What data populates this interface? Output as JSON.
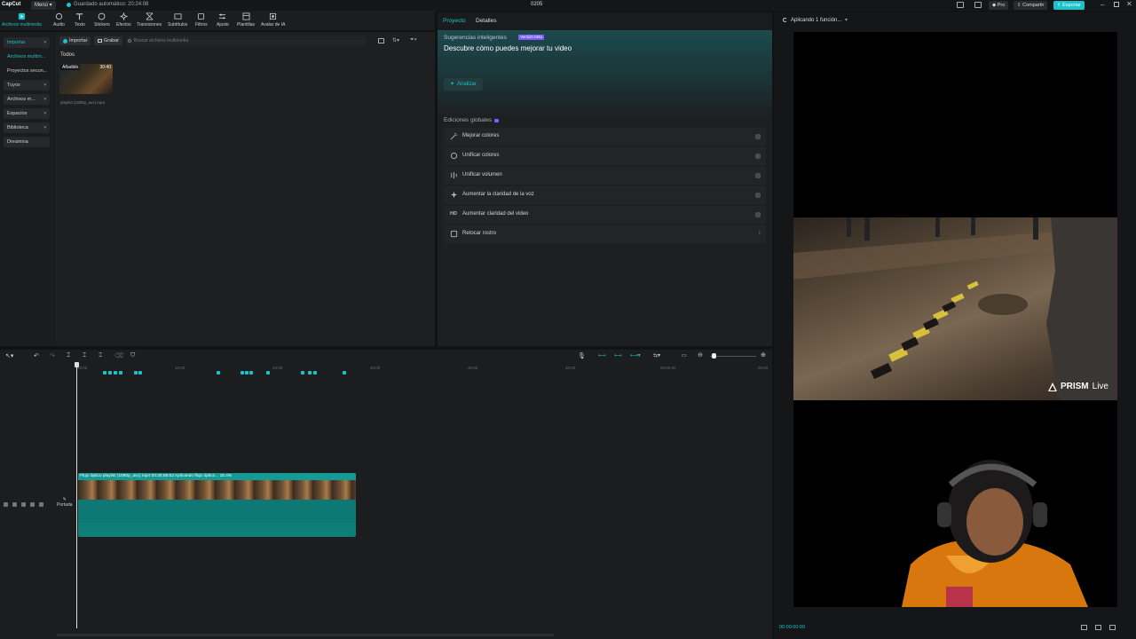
{
  "topbar": {
    "logo": "CapCut",
    "menu": "Menú",
    "autosave": "Guardado automático: 20:24:08",
    "project_title": "0205",
    "pro": "Pro",
    "share": "Compartir",
    "export": "Exportar"
  },
  "toolbar": {
    "items": [
      "Archivos multimedia",
      "Audio",
      "Texto",
      "Stickers",
      "Efectos",
      "Transiciones",
      "Subtítulos",
      "Filtros",
      "Ajuste",
      "Plantillas",
      "Avatar de IA"
    ]
  },
  "sidebar": {
    "items": [
      "Importar",
      "Archivos multim...",
      "Proyectos secun...",
      "Tuyos",
      "Archivos m...",
      "Espacios",
      "Biblioteca",
      "Dreamina"
    ]
  },
  "media": {
    "import_btn": "Importar",
    "record_btn": "Grabar",
    "search_placeholder": "Buscar archivos multimedia",
    "filter_label": "Todos",
    "thumb_badge": "Añadido",
    "thumb_duration": "30:40",
    "thumb_name": "playlist (1080p_avc).mp4"
  },
  "center": {
    "tabs": [
      "Proyecto",
      "Detalles"
    ],
    "smart_label": "Sugerencias inteligentes",
    "beta": "Versión beta",
    "smart_title": "Descubre cómo puedes mejorar tu video",
    "analyze": "Analizar",
    "global_label": "Ediciones globales",
    "rows": [
      "Mejorar colores",
      "Unificar colores",
      "Unificar volumen",
      "Aumentar la claridad de la voz",
      "Aumentar claridad del video",
      "Retocar rostro"
    ],
    "row_hd": "HD"
  },
  "preview": {
    "status": "Aplicando 1 función...",
    "watermark_brand": "PRISM",
    "watermark_live": "Live",
    "timecode": "00:00:00:00"
  },
  "timeline": {
    "ticks": [
      "00:00",
      "10:00",
      "20:00",
      "40:00",
      "40:00",
      "40:00",
      "00:00:00",
      "00:00"
    ],
    "clip_label": "Flujo óptico   playlist (1080p_avc).mp4   00:25:58:52   Aplicando flujo óptico... 15.4%",
    "cover": "Portada"
  },
  "colors": {
    "accent": "#19c3c9",
    "clip": "#0e7874",
    "beta": "#7b5cff"
  }
}
